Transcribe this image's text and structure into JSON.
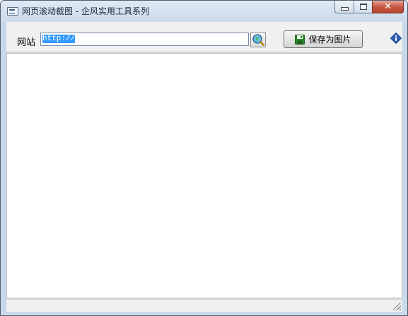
{
  "window": {
    "title": "网页滚动截图 - 企风实用工具系列",
    "icon": "app-window-icon",
    "controls": {
      "minimize_icon": "minimize-icon",
      "maximize_icon": "maximize-icon",
      "close_label": "✕"
    }
  },
  "toolbar": {
    "url_label": "网站",
    "url_value": "http://",
    "go_icon": "search-go-icon",
    "save_label": "保存为图片",
    "save_icon": "floppy-disk-icon",
    "info_icon": "info-icon"
  },
  "colors": {
    "selection": "#3399ff",
    "close_button": "#c75a45",
    "save_icon": "#2c8a2c",
    "info_icon": "#2f5fb6"
  }
}
